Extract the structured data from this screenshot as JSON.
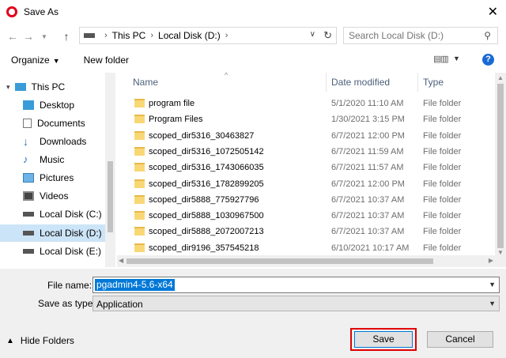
{
  "window": {
    "title": "Save As"
  },
  "nav": {
    "breadcrumb": [
      "This PC",
      "Local Disk (D:)"
    ],
    "search_placeholder": "Search Local Disk (D:)"
  },
  "toolbar": {
    "organize_label": "Organize",
    "new_folder_label": "New folder",
    "help_label": "?"
  },
  "sidebar": {
    "items": [
      {
        "label": "This PC",
        "icon": "computer-icon",
        "top": 0
      },
      {
        "label": "Desktop",
        "icon": "desktop-icon"
      },
      {
        "label": "Documents",
        "icon": "documents-icon"
      },
      {
        "label": "Downloads",
        "icon": "downloads-icon"
      },
      {
        "label": "Music",
        "icon": "music-icon"
      },
      {
        "label": "Pictures",
        "icon": "pictures-icon"
      },
      {
        "label": "Videos",
        "icon": "videos-icon"
      },
      {
        "label": "Local Disk (C:)",
        "icon": "drive-icon"
      },
      {
        "label": "Local Disk (D:)",
        "icon": "drive-icon",
        "selected": true
      },
      {
        "label": "Local Disk (E:)",
        "icon": "drive-icon"
      }
    ]
  },
  "file_list": {
    "columns": [
      "Name",
      "Date modified",
      "Type"
    ],
    "rows": [
      {
        "name": "program file",
        "date": "5/1/2020 11:10 AM",
        "type": "File folder"
      },
      {
        "name": "Program Files",
        "date": "1/30/2021 3:15 PM",
        "type": "File folder"
      },
      {
        "name": "scoped_dir5316_30463827",
        "date": "6/7/2021 12:00 PM",
        "type": "File folder"
      },
      {
        "name": "scoped_dir5316_1072505142",
        "date": "6/7/2021 11:59 AM",
        "type": "File folder"
      },
      {
        "name": "scoped_dir5316_1743066035",
        "date": "6/7/2021 11:57 AM",
        "type": "File folder"
      },
      {
        "name": "scoped_dir5316_1782899205",
        "date": "6/7/2021 12:00 PM",
        "type": "File folder"
      },
      {
        "name": "scoped_dir5888_775927796",
        "date": "6/7/2021 10:37 AM",
        "type": "File folder"
      },
      {
        "name": "scoped_dir5888_1030967500",
        "date": "6/7/2021 10:37 AM",
        "type": "File folder"
      },
      {
        "name": "scoped_dir5888_2072007213",
        "date": "6/7/2021 10:37 AM",
        "type": "File folder"
      },
      {
        "name": "scoped_dir9196_357545218",
        "date": "6/10/2021 10:17 AM",
        "type": "File folder"
      }
    ]
  },
  "form": {
    "file_name_label": "File name:",
    "file_name_value": "pgadmin4-5.6-x64",
    "save_type_label": "Save as type:",
    "save_type_value": "Application"
  },
  "footer": {
    "hide_folders_label": "Hide Folders",
    "save_label": "Save",
    "cancel_label": "Cancel"
  },
  "colors": {
    "accent": "#0078d7",
    "highlight": "#e00000",
    "selected": "#cce4f7"
  }
}
